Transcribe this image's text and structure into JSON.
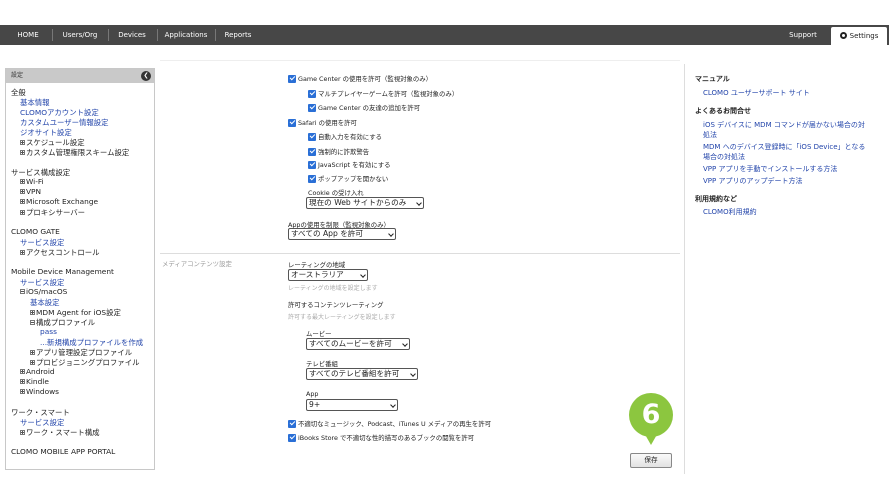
{
  "nav": {
    "items": [
      "HOME",
      "Users/Org",
      "Devices",
      "Applications",
      "Reports"
    ],
    "support": "Support",
    "settings": "Settings"
  },
  "sidebar": {
    "header": "設定",
    "lines": [
      {
        "text": "全般",
        "indent": 0,
        "link": false,
        "toggle": ""
      },
      {
        "text": "基本情報",
        "indent": 1,
        "link": true,
        "toggle": ""
      },
      {
        "text": "CLOMOアカウント設定",
        "indent": 1,
        "link": true,
        "toggle": ""
      },
      {
        "text": "カスタムユーザー情報設定",
        "indent": 1,
        "link": true,
        "toggle": ""
      },
      {
        "text": "ジオサイト設定",
        "indent": 1,
        "link": true,
        "toggle": ""
      },
      {
        "text": "スケジュール設定",
        "indent": 1,
        "link": false,
        "toggle": "plus"
      },
      {
        "text": "カスタム管理権限スキーム設定",
        "indent": 1,
        "link": false,
        "toggle": "plus"
      },
      {
        "text": "",
        "indent": 0,
        "link": false,
        "toggle": ""
      },
      {
        "text": "サービス構成設定",
        "indent": 0,
        "link": false,
        "toggle": ""
      },
      {
        "text": "Wi-Fi",
        "indent": 1,
        "link": false,
        "toggle": "plus"
      },
      {
        "text": "VPN",
        "indent": 1,
        "link": false,
        "toggle": "plus"
      },
      {
        "text": "Microsoft Exchange",
        "indent": 1,
        "link": false,
        "toggle": "plus"
      },
      {
        "text": "プロキシサーバー",
        "indent": 1,
        "link": false,
        "toggle": "plus"
      },
      {
        "text": "",
        "indent": 0,
        "link": false,
        "toggle": ""
      },
      {
        "text": "CLOMO GATE",
        "indent": 0,
        "link": false,
        "toggle": ""
      },
      {
        "text": "サービス設定",
        "indent": 1,
        "link": true,
        "toggle": ""
      },
      {
        "text": "アクセスコントロール",
        "indent": 1,
        "link": false,
        "toggle": "plus"
      },
      {
        "text": "",
        "indent": 0,
        "link": false,
        "toggle": ""
      },
      {
        "text": "Mobile Device Management",
        "indent": 0,
        "link": false,
        "toggle": ""
      },
      {
        "text": "サービス設定",
        "indent": 1,
        "link": true,
        "toggle": ""
      },
      {
        "text": "iOS/macOS",
        "indent": 1,
        "link": false,
        "toggle": "minus"
      },
      {
        "text": "基本設定",
        "indent": 2,
        "link": true,
        "toggle": ""
      },
      {
        "text": "MDM Agent for iOS設定",
        "indent": 2,
        "link": false,
        "toggle": "plus"
      },
      {
        "text": "構成プロファイル",
        "indent": 2,
        "link": false,
        "toggle": "minus"
      },
      {
        "text": "pass",
        "indent": 3,
        "link": true,
        "toggle": ""
      },
      {
        "text": "...新規構成プロファイルを作成",
        "indent": 3,
        "link": true,
        "toggle": ""
      },
      {
        "text": "アプリ管理設定プロファイル",
        "indent": 2,
        "link": false,
        "toggle": "plus"
      },
      {
        "text": "プロビジョニングプロファイル",
        "indent": 2,
        "link": false,
        "toggle": "plus"
      },
      {
        "text": "Android",
        "indent": 1,
        "link": false,
        "toggle": "plus"
      },
      {
        "text": "Kindle",
        "indent": 1,
        "link": false,
        "toggle": "plus"
      },
      {
        "text": "Windows",
        "indent": 1,
        "link": false,
        "toggle": "plus"
      },
      {
        "text": "",
        "indent": 0,
        "link": false,
        "toggle": ""
      },
      {
        "text": "ワーク・スマート",
        "indent": 0,
        "link": false,
        "toggle": ""
      },
      {
        "text": "サービス設定",
        "indent": 1,
        "link": true,
        "toggle": ""
      },
      {
        "text": "ワーク・スマート構成",
        "indent": 1,
        "link": false,
        "toggle": "plus"
      },
      {
        "text": "",
        "indent": 0,
        "link": false,
        "toggle": ""
      },
      {
        "text": "CLOMO MOBILE APP PORTAL",
        "indent": 0,
        "link": false,
        "toggle": ""
      }
    ]
  },
  "main": {
    "game_center": "Game Center の使用を許可（監視対象のみ）",
    "multiplayer": "マルチプレイヤーゲームを許可（監視対象のみ）",
    "add_friends": "Game Center の友達の追加を許可",
    "safari": "Safari の使用を許可",
    "autofill": "自動入力を有効にする",
    "fraud_warning": "強制的に詐欺警告",
    "javascript": "JavaScript を有効にする",
    "popups": "ポップアップを開かない",
    "cookie_label": "Cookie の受け入れ",
    "cookie_value": "現在の Web サイトからのみ",
    "app_usage_label": "Appの使用を制限（監視対象のみ）",
    "app_usage_value": "すべての App を許可",
    "media_section": "メディアコンテンツ設定",
    "rating_region_label": "レーティングの地域",
    "rating_region_value": "オーストラリア",
    "rating_region_hint": "レーティングの地域を設定します",
    "allowed_ratings_label": "許可するコンテンツレーティング",
    "allowed_ratings_hint": "許可する最大レーティングを設定します",
    "movies_label": "ムービー",
    "movies_value": "すべてのムービーを許可",
    "tv_label": "テレビ番組",
    "tv_value": "すべてのテレビ番組を許可",
    "app_label": "App",
    "app_value": "9+",
    "explicit_media": "不適切なミュージック、Podcast、iTunes U メディアの再生を許可",
    "ibooks": "iBooks Store で不適切な性的描写のあるブックの閲覧を許可",
    "save": "保存",
    "step": "6"
  },
  "right": {
    "manual_head": "マニュアル",
    "manual_link": "CLOMO ユーザーサポート サイト",
    "faq_head": "よくあるお問合せ",
    "faq_links": [
      "iOS デバイスに MDM コマンドが届かない場合の対",
      "処法",
      "MDM へのデバイス登録時に「iOS Device」となる",
      "場合の対処法",
      "VPP アプリを手動でインストールする方法",
      "VPP アプリのアップデート方法"
    ],
    "terms_head": "利用規約など",
    "terms_link": "CLOMO利用規約"
  },
  "colors": {
    "nav_bg": "#474747",
    "accent": "#2a6fd6",
    "badge": "#8cc63f",
    "link": "#2244aa"
  }
}
